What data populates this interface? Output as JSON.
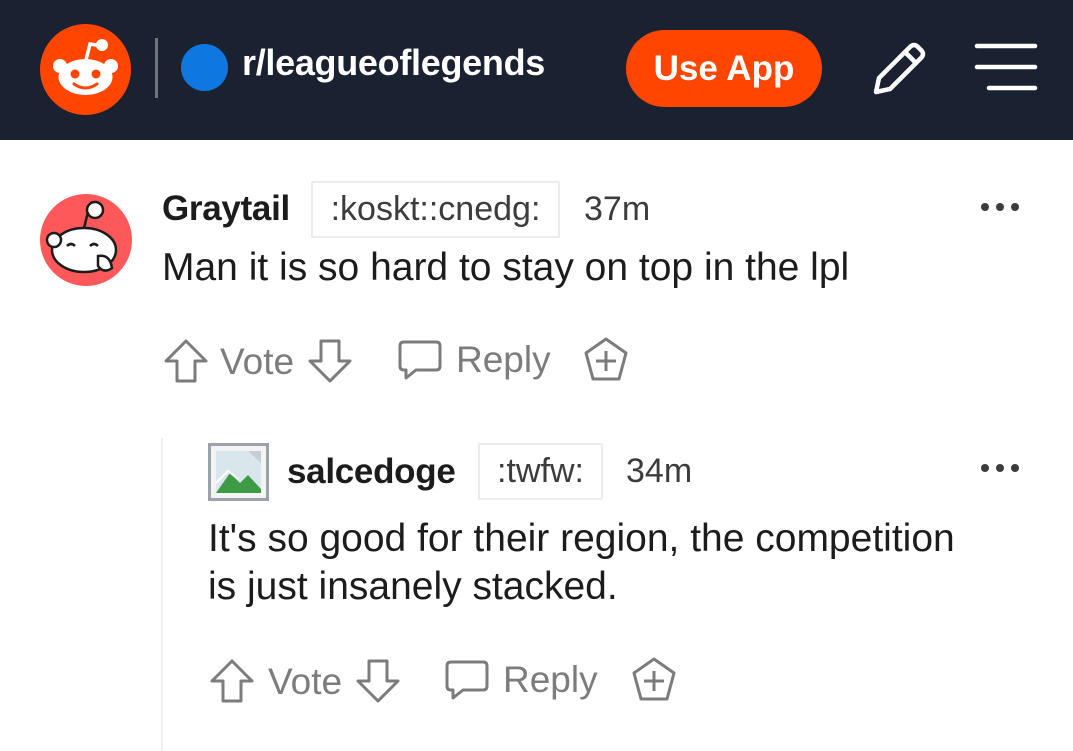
{
  "header": {
    "subreddit": "r/leagueoflegends",
    "use_app_label": "Use App",
    "brand_color": "#ff4500",
    "subreddit_icon_color": "#0f78e0",
    "background_color": "#1a2130"
  },
  "comments": [
    {
      "author": "Graytail",
      "flair": ":koskt::cnedg:",
      "time": "37m",
      "body": "Man it is so hard to stay on top in the lpl",
      "vote_label": "Vote",
      "reply_label": "Reply"
    },
    {
      "author": "salcedoge",
      "flair": ":twfw:",
      "time": "34m",
      "body_line1": "It's so good for their region, the competition",
      "body_line2": "is just insanely stacked.",
      "vote_label": "Vote",
      "reply_label": "Reply"
    }
  ]
}
